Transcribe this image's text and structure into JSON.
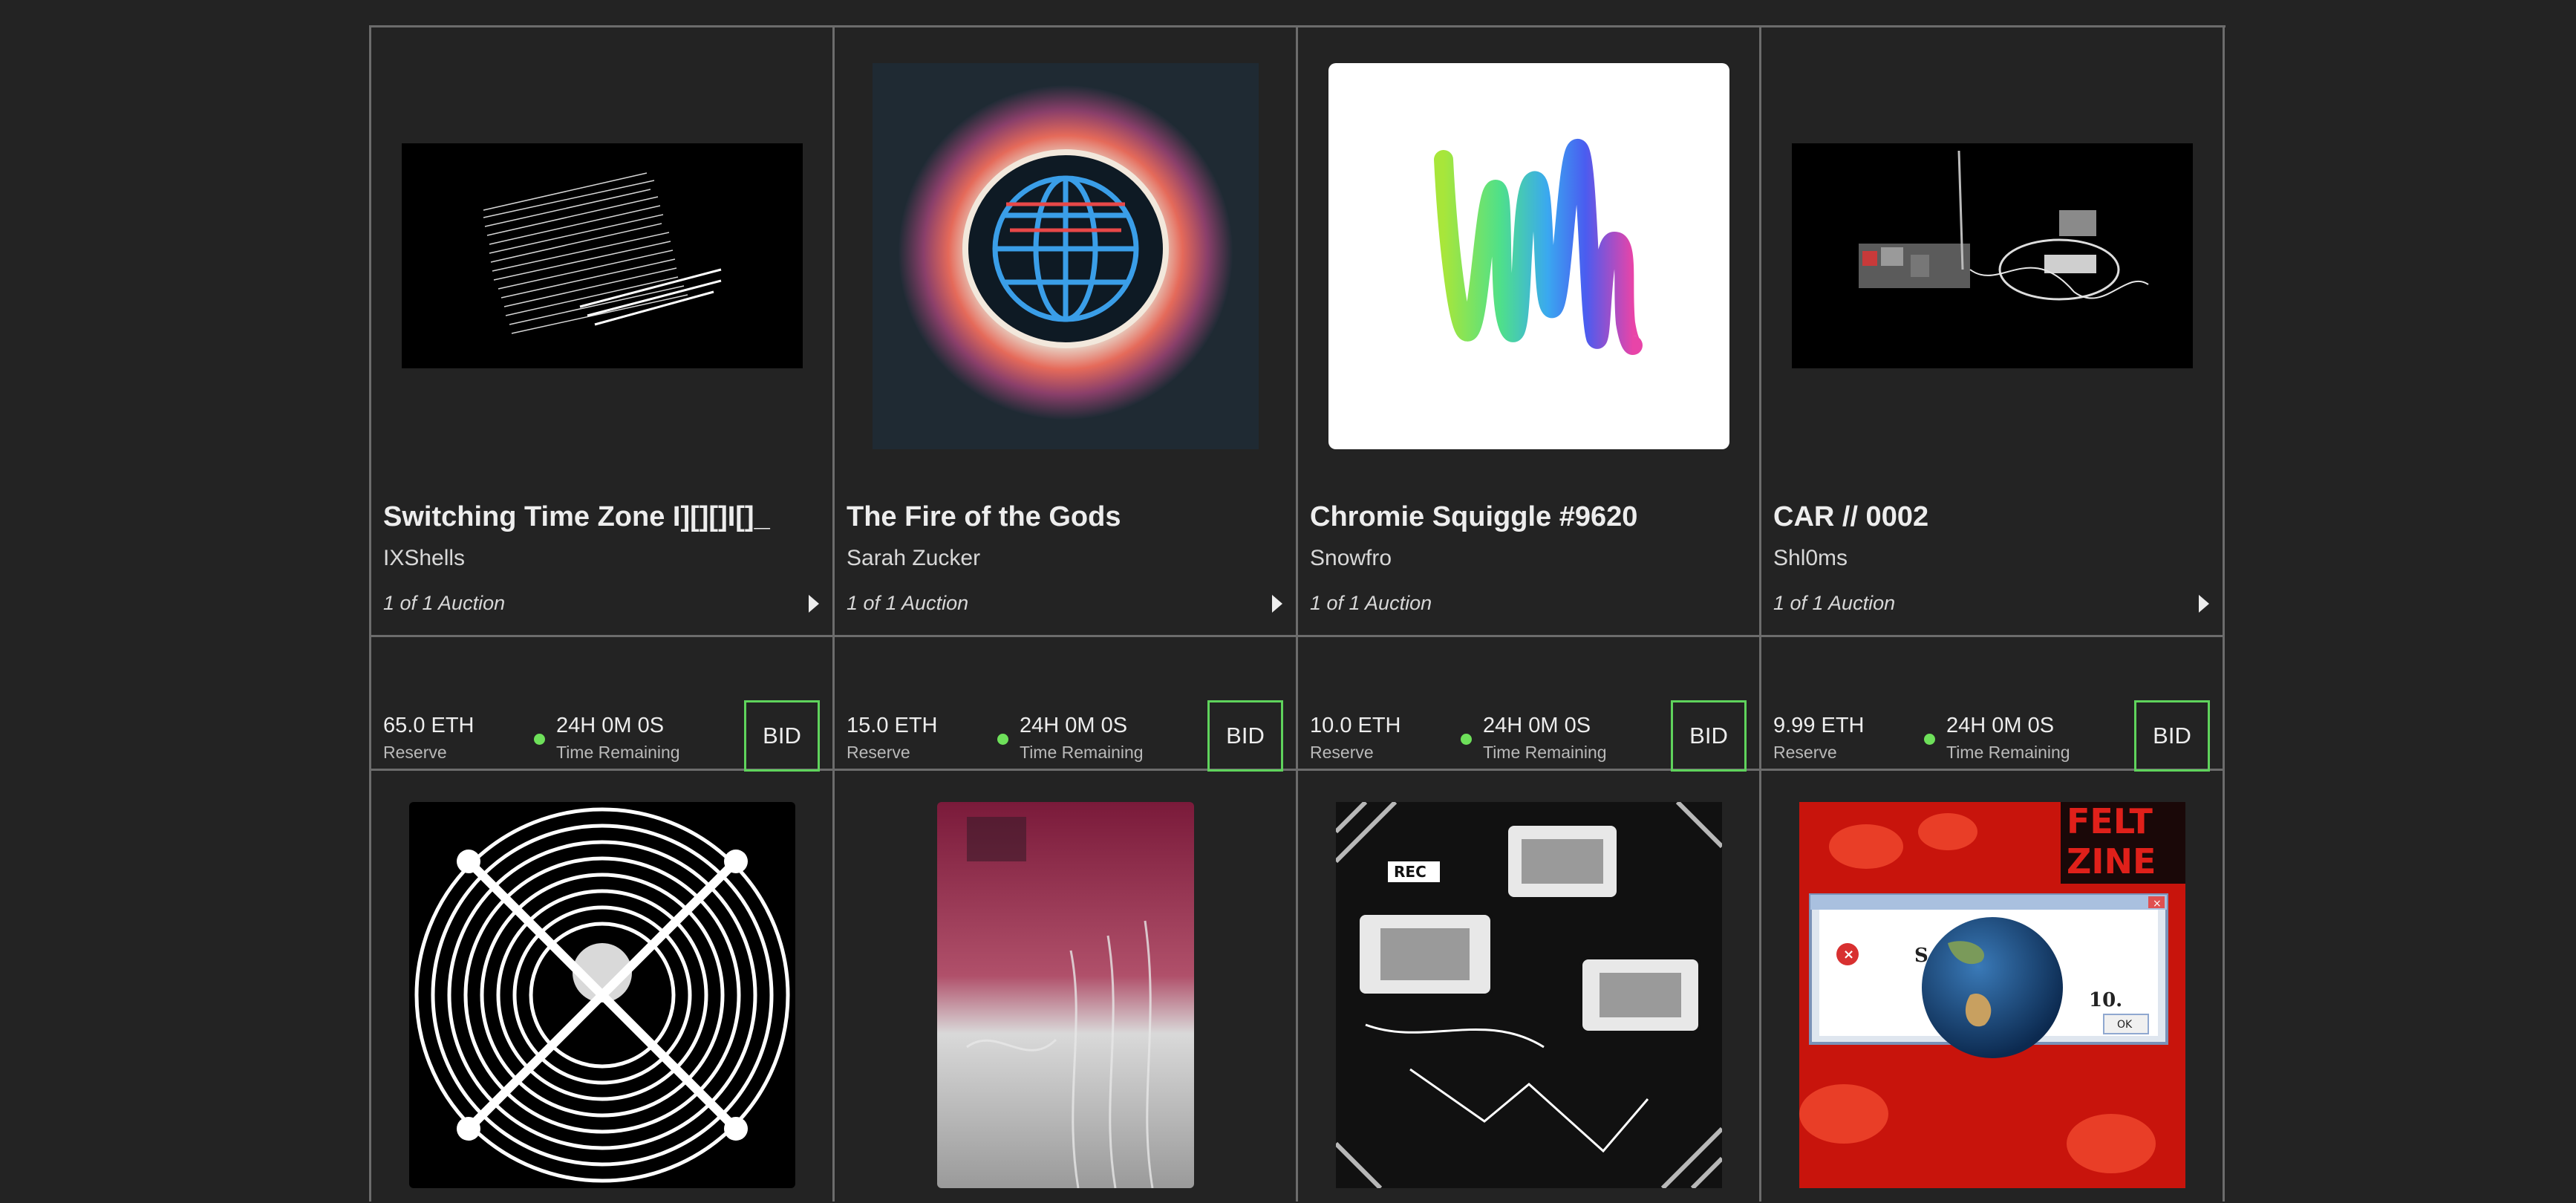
{
  "cards": [
    {
      "title": "Switching Time Zone I][][]I[]_",
      "artist": "IXShells",
      "edition": "1 of 1 Auction",
      "reserve_value": "65.0 ETH",
      "reserve_label": "Reserve",
      "time_value": "24H 0M 0S",
      "time_label": "Time Remaining",
      "bid_label": "BID"
    },
    {
      "title": "The Fire of the Gods",
      "artist": "Sarah Zucker",
      "edition": "1 of 1 Auction",
      "reserve_value": "15.0 ETH",
      "reserve_label": "Reserve",
      "time_value": "24H 0M 0S",
      "time_label": "Time Remaining",
      "bid_label": "BID"
    },
    {
      "title": "Chromie Squiggle #9620",
      "artist": "Snowfro",
      "edition": "1 of 1 Auction",
      "reserve_value": "10.0 ETH",
      "reserve_label": "Reserve",
      "time_value": "24H 0M 0S",
      "time_label": "Time Remaining",
      "bid_label": "BID"
    },
    {
      "title": "CAR // 0002",
      "artist": "Shl0ms",
      "edition": "1 of 1 Auction",
      "reserve_value": "9.99 ETH",
      "reserve_label": "Reserve",
      "time_value": "24H 0M 0S",
      "time_label": "Time Remaining",
      "bid_label": "BID"
    }
  ],
  "row2": {
    "feltzine_logo": [
      "FELT",
      "ZINE"
    ],
    "dialog_text_1": "S            E TO",
    "dialog_text_2": "10.",
    "dialog_ok": "OK",
    "camera_label": "REC"
  },
  "colors": {
    "background": "#232323",
    "border": "#6c6c6c",
    "accent_green": "#5fd35c",
    "status_dot": "#6ee05a"
  }
}
